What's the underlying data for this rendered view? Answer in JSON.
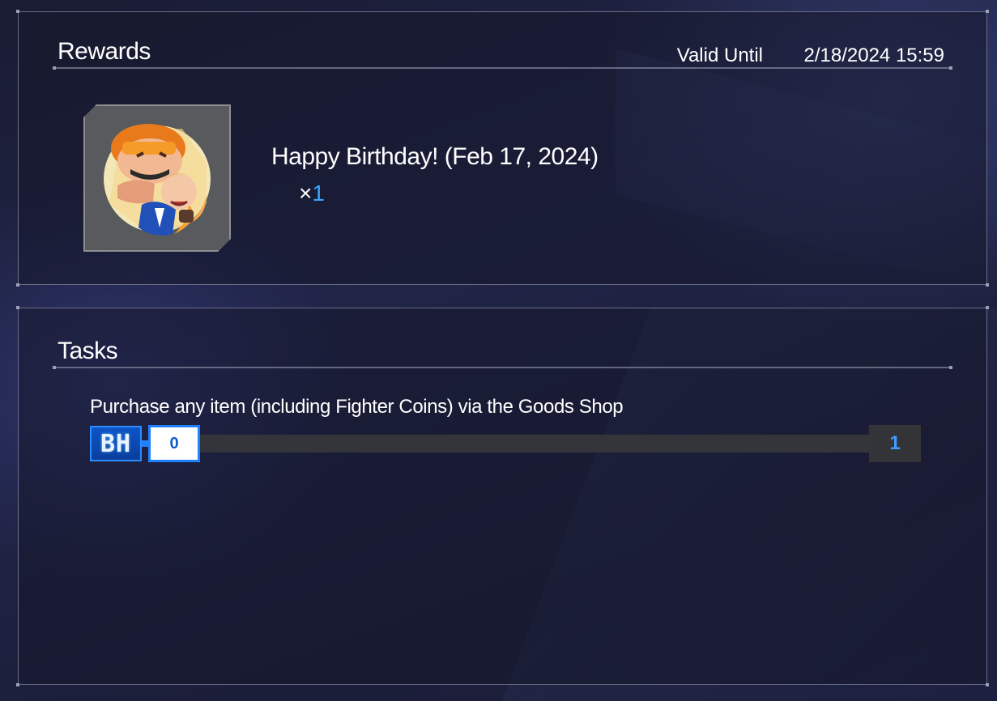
{
  "rewards": {
    "title": "Rewards",
    "valid_label": "Valid Until",
    "valid_date": "2/18/2024 15:59",
    "item": {
      "name": "Happy Birthday! (Feb 17, 2024)",
      "qty_symbol": "×",
      "qty_value": "1",
      "icon": "character-sticker-icon"
    }
  },
  "tasks": {
    "title": "Tasks",
    "items": [
      {
        "text": "Purchase any item (including Fighter Coins) via the Goods Shop",
        "badge": "BH",
        "current": "0",
        "target": "1",
        "progress": 0
      }
    ]
  },
  "colors": {
    "accent_blue": "#39a6ff",
    "badge_blue": "#0d55c8",
    "track_gray": "#34353a"
  }
}
